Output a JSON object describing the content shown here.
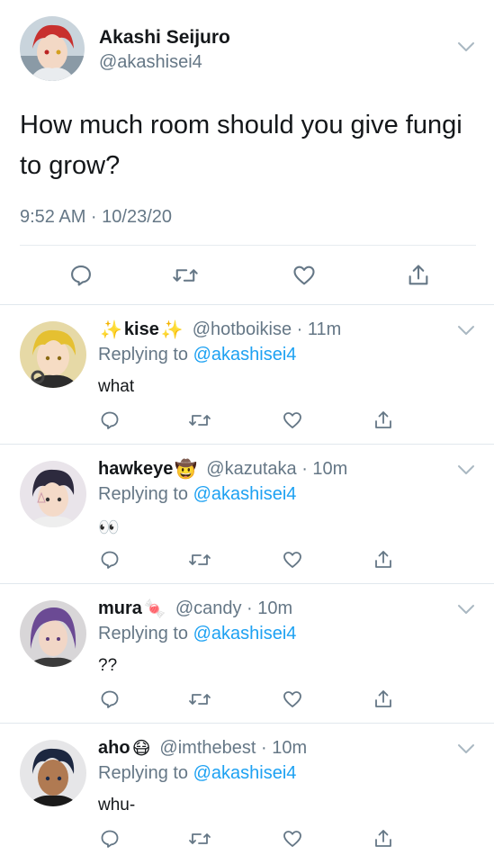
{
  "main_tweet": {
    "display_name": "Akashi Seijuro",
    "handle": "@akashisei4",
    "text": "How much room should you give fungi to grow?",
    "timestamp": "9:52 AM · 10/23/20",
    "icons": [
      "reply-icon",
      "retweet-icon",
      "like-icon",
      "share-icon",
      "chevron-down-icon"
    ]
  },
  "replies": [
    {
      "name_prefix": "✨",
      "name": "kise",
      "name_suffix": "✨",
      "meta": "@hotboikise · 11m",
      "replying_prefix": "Replying to",
      "replying_handle": "@akashisei4",
      "text": "what",
      "avatar_color": "#e8c23a"
    },
    {
      "name_prefix": "",
      "name": "hawkeye",
      "name_suffix": "🤠",
      "meta": "@kazutaka · 10m",
      "replying_prefix": "Replying to",
      "replying_handle": "@akashisei4",
      "text": "👀",
      "avatar_color": "#3a3550"
    },
    {
      "name_prefix": "",
      "name": "mura",
      "name_suffix": "🍬",
      "meta": "@candy · 10m",
      "replying_prefix": "Replying to",
      "replying_handle": "@akashisei4",
      "text": "??",
      "avatar_color": "#6a4c8c"
    },
    {
      "name_prefix": "",
      "name": "aho",
      "name_suffix": "😷",
      "meta": "@imthebest · 10m",
      "replying_prefix": "Replying to",
      "replying_handle": "@akashisei4",
      "text": "whu-",
      "avatar_color": "#1f2a4a"
    }
  ],
  "colors": {
    "text": "#14171a",
    "secondary": "#657786",
    "link": "#1da1f2",
    "divider": "#e1e8ed"
  }
}
